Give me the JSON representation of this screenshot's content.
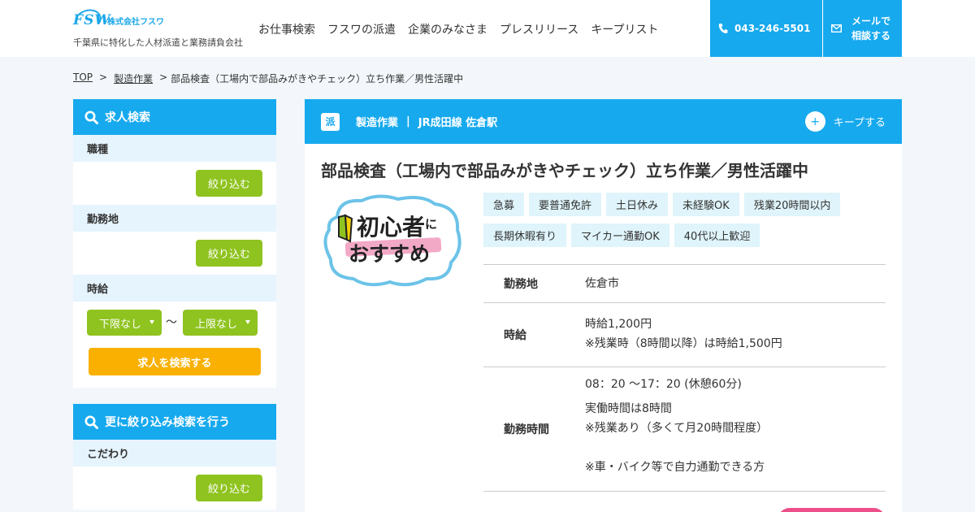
{
  "header": {
    "logo_text": "FSW",
    "company": "株式会社フスワ",
    "tagline": "千葉県に特化した人材派遣と業務請負会社",
    "nav": [
      "お仕事検索",
      "フスワの派遣",
      "企業のみなさま",
      "プレスリリース",
      "キープリスト"
    ],
    "phone": "043-246-5501",
    "mail_line1": "メールで",
    "mail_line2": "相談する"
  },
  "breadcrumb": {
    "top": "TOP",
    "sep": ">",
    "category": "製造作業",
    "current": "部品検査（工場内で部品みがきやチェック）立ち作業／男性活躍中"
  },
  "sidebar": {
    "search_title": "求人検索",
    "job_type_label": "職種",
    "location_label": "勤務地",
    "wage_label": "時給",
    "narrow_label": "絞り込む",
    "wage_min": "下限なし",
    "wage_tilde": "〜",
    "wage_max": "上限なし",
    "search_button": "求人を検索する",
    "refine_title": "更に絞り込み検索を行う",
    "kodawari_label": "こだわり"
  },
  "job": {
    "badge": "派",
    "category": "製造作業",
    "separator": "|",
    "station": "JR成田線 佐倉駅",
    "keep_label": "キープする",
    "keep_icon": "+",
    "title": "部品検査（工場内で部品みがきやチェック）立ち作業／男性活躍中",
    "image_text_line1": "初心者",
    "image_text_ni": "に",
    "image_text_line2": "おすすめ",
    "tags": [
      "急募",
      "要普通免許",
      "土日休み",
      "未経験OK",
      "残業20時間以内",
      "長期休暇有り",
      "マイカー通勤OK",
      "40代以上歓迎"
    ],
    "info": {
      "location_key": "勤務地",
      "location_val": "佐倉市",
      "wage_key": "時給",
      "wage_val1": "時給1,200円",
      "wage_val2": "※残業時（8時間以降）は時給1,500円",
      "hours_key": "勤務時間",
      "hours_val1": "08：20 〜17：20 (休憩60分)",
      "hours_val2": "実働時間は8時間",
      "hours_val3": "※残業あり（多くて月20時間程度）",
      "hours_val4": "※車・バイク等で自力通勤できる方"
    }
  },
  "colors": {
    "primary": "#16a9ee",
    "green": "#8fc31f",
    "orange": "#f9b000",
    "tag_bg": "#dff4fb",
    "pink": "#ec4f8a"
  }
}
